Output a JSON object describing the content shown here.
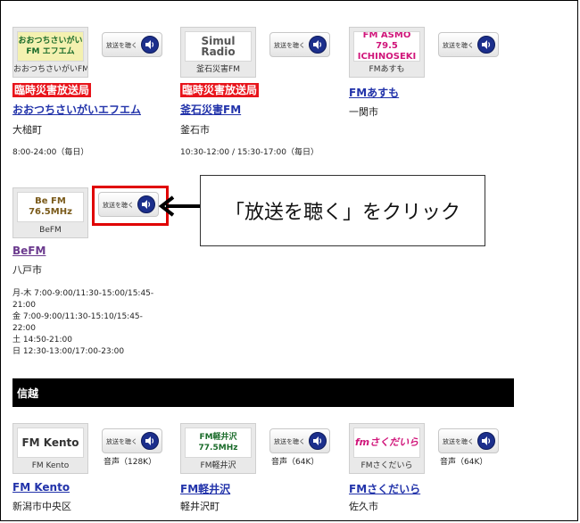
{
  "listen_button_label": "放送を聴く",
  "callout_text": "「放送を聴く」をクリック",
  "section_title": "信越",
  "stations_top": [
    {
      "logo_text": "おおつちさいがいFM エフエム",
      "logo_caption": "おおつちさいがいFM",
      "disaster_badge": "臨時災害放送局",
      "name": "おおつちさいがいエフエム",
      "city": "大槌町",
      "hours": [
        "8:00-24:00（毎日）"
      ]
    },
    {
      "logo_text": "Simul Radio",
      "logo_caption": "釜石災害FM",
      "disaster_badge": "臨時災害放送局",
      "name": "釜石災害FM",
      "city": "釜石市",
      "hours": [
        "10:30-12:00 / 15:30-17:00（毎日）"
      ]
    },
    {
      "logo_text": "FM ASMO 79.5 ICHINOSEKI",
      "logo_caption": "FMあすも",
      "name": "FMあすも",
      "city": "一関市"
    }
  ],
  "station_befm": {
    "logo_text": "Be FM 76.5MHz",
    "logo_caption": "BeFM",
    "name": "BeFM",
    "city": "八戸市",
    "hours": [
      "月-木 7:00-9:00/11:30-15:00/15:45-",
      "21:00",
      "金 7:00-9:00/11:30-15:10/15:45-",
      "22:00",
      "土 14:50-21:00",
      "日 12:30-13:00/17:00-23:00"
    ]
  },
  "stations_shinetsu": [
    {
      "logo_text": "FM Kento",
      "logo_caption": "FM Kento",
      "quality": "音声（128K）",
      "name": "FM Kento",
      "city": "新潟市中央区"
    },
    {
      "logo_text": "FM軽井沢 77.5MHz",
      "logo_caption": "FM軽井沢",
      "quality": "音声（64K）",
      "name": "FM軽井沢",
      "city": "軽井沢町"
    },
    {
      "logo_text": "fmさくだいら",
      "logo_caption": "FMさくだいら",
      "quality": "音声（64K）",
      "name": "FMさくだいら",
      "city": "佐久市"
    }
  ],
  "colors": {
    "disaster_badge_bg": "#e8141b",
    "link": "#2233aa",
    "visited_link": "#6b3a8e",
    "highlight": "#e00000",
    "speaker_icon": "#1c2f8c"
  }
}
